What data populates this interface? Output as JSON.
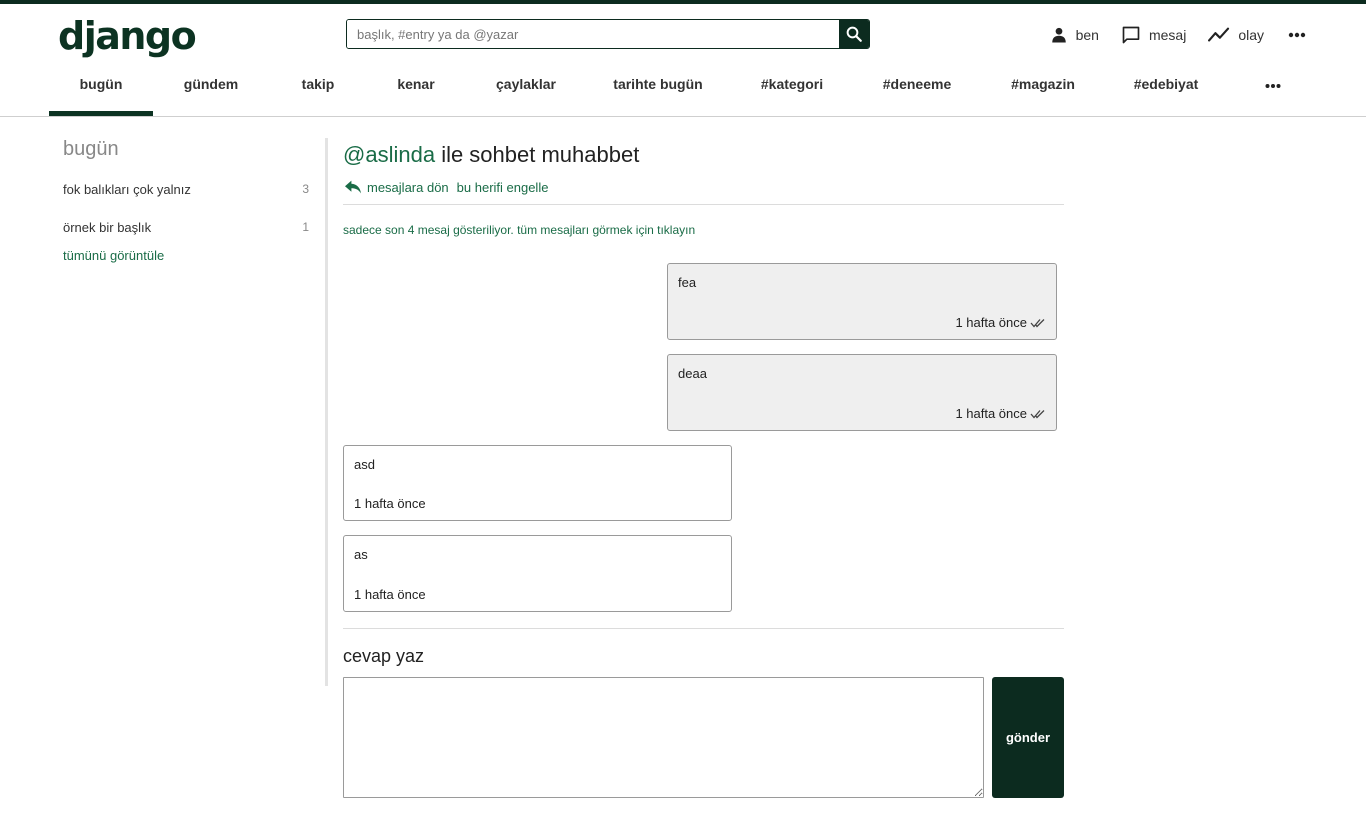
{
  "app": {
    "logo": "django"
  },
  "search": {
    "placeholder": "başlık, #entry ya da @yazar"
  },
  "user_nav": {
    "profile_label": "ben",
    "messages_label": "mesaj",
    "activity_label": "olay"
  },
  "categories": [
    {
      "label": "bugün",
      "active": true
    },
    {
      "label": "gündem"
    },
    {
      "label": "takip"
    },
    {
      "label": "kenar"
    },
    {
      "label": "çaylaklar"
    },
    {
      "label": "tarihte bugün"
    },
    {
      "label": "#kategori"
    },
    {
      "label": "#deneeme"
    },
    {
      "label": "#magazin"
    },
    {
      "label": "#edebiyat"
    }
  ],
  "sidebar": {
    "title": "bugün",
    "items": [
      {
        "label": "fok balıkları çok yalnız",
        "count": "3"
      },
      {
        "label": "örnek bir başlık",
        "count": "1"
      }
    ],
    "more_label": "tümünü görüntüle"
  },
  "conversation": {
    "handle": "@aslinda",
    "title_suffix": "ile sohbet muhabbet",
    "back_label": "mesajlara dön",
    "block_label": "bu herifi engelle",
    "notice": "sadece son 4 mesaj gösteriliyor. tüm mesajları görmek için tıklayın",
    "messages": [
      {
        "text": "fea",
        "time": "1 hafta önce",
        "direction": "sent",
        "read": true
      },
      {
        "text": "deaa",
        "time": "1 hafta önce",
        "direction": "sent",
        "read": true
      },
      {
        "text": "asd",
        "time": "1 hafta önce",
        "direction": "received"
      },
      {
        "text": "as",
        "time": "1 hafta önce",
        "direction": "received"
      }
    ]
  },
  "reply": {
    "title": "cevap yaz",
    "value": "",
    "send_label": "gönder"
  },
  "colors": {
    "brand": "#0c2b1f",
    "link": "#1a6c47",
    "sent_bubble": "#efefef"
  }
}
